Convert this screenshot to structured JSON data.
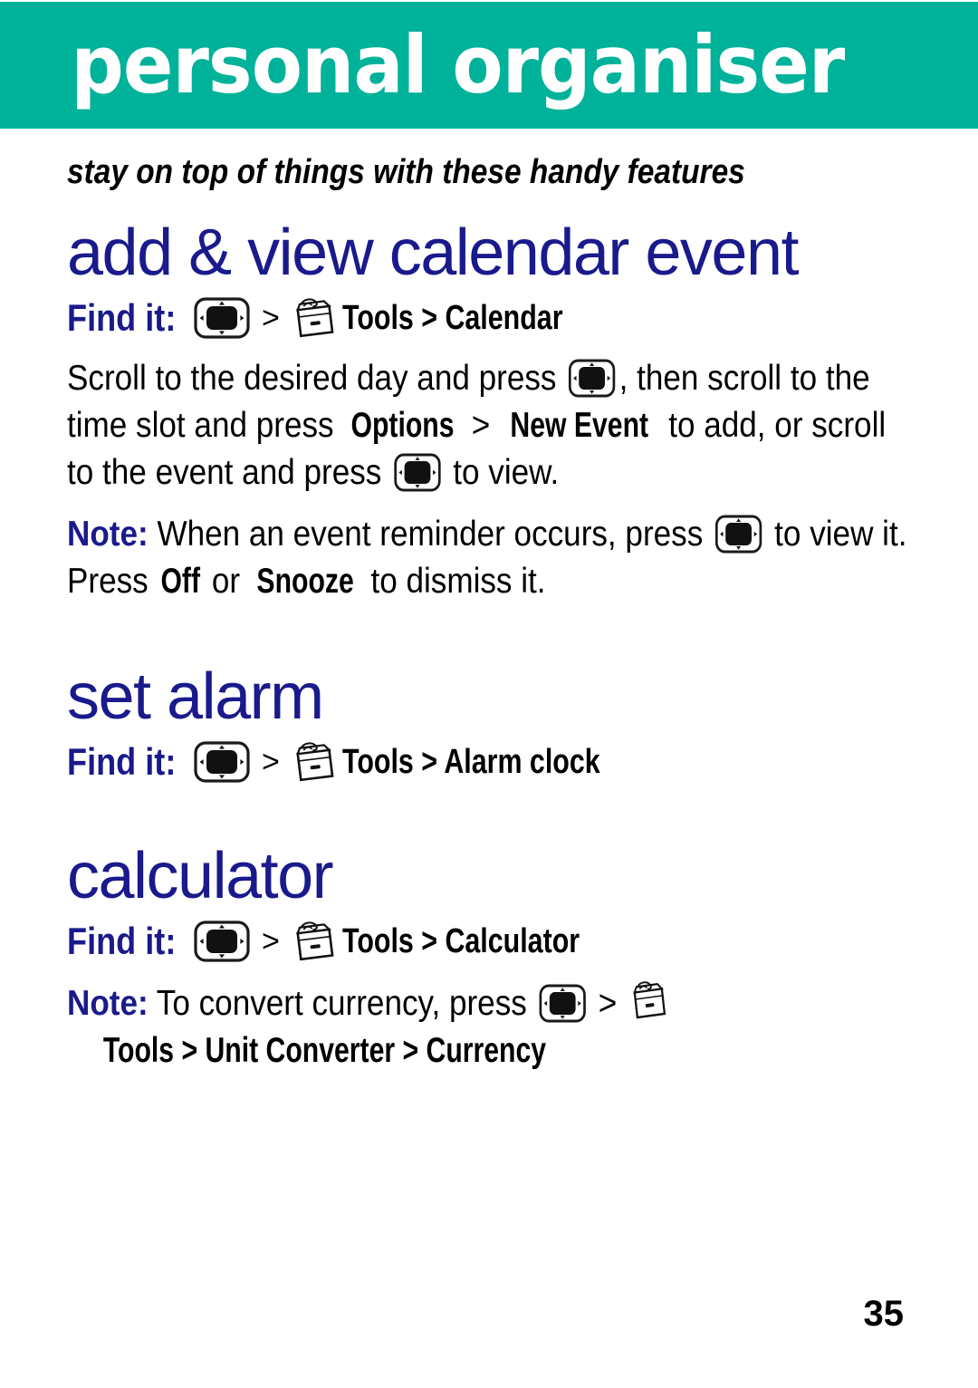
{
  "page": {
    "title": "personal organiser",
    "subtitle": "stay on top of things with these handy features",
    "page_number": "35",
    "colors": {
      "header_band": "#00B29A",
      "heading_blue": "#1A1A8C",
      "body_black": "#000000",
      "title_white": "#FFFFFF"
    }
  },
  "icons": {
    "nav_key": "navigation-key-icon",
    "tools": "tools-card-file-icon",
    "separator": ">"
  },
  "sections": [
    {
      "id": "calendar",
      "heading": "add & view calendar event",
      "find_it": {
        "label": "Find it:",
        "sep1": ">",
        "sep2": ">",
        "path_app": "Tools",
        "path_item": "Calendar",
        "path_full": "Tools > Calendar"
      },
      "paragraphs": [
        {
          "id": "calendar-steps",
          "parts": [
            {
              "t": "text",
              "v": "Scroll to the desired day and press "
            },
            {
              "t": "navkey"
            },
            {
              "t": "text",
              "v": ", then scroll to the time slot and press "
            },
            {
              "t": "ui",
              "v": "Options"
            },
            {
              "t": "text",
              "v": " > "
            },
            {
              "t": "ui",
              "v": "New Event"
            },
            {
              "t": "text",
              "v": " to add, or scroll to the event and press "
            },
            {
              "t": "navkey"
            },
            {
              "t": "text",
              "v": " to view."
            }
          ]
        },
        {
          "id": "calendar-note",
          "parts": [
            {
              "t": "note",
              "v": "Note:"
            },
            {
              "t": "text",
              "v": " When an event reminder occurs, press "
            },
            {
              "t": "navkey"
            },
            {
              "t": "text",
              "v": " to view it. Press "
            },
            {
              "t": "ui",
              "v": "Off"
            },
            {
              "t": "text",
              "v": " or "
            },
            {
              "t": "ui",
              "v": "Snooze"
            },
            {
              "t": "text",
              "v": " to dismiss it."
            }
          ]
        }
      ]
    },
    {
      "id": "alarm",
      "heading": "set alarm",
      "find_it": {
        "label": "Find it:",
        "sep1": ">",
        "sep2": ">",
        "path_app": "Tools",
        "path_item": "Alarm clock",
        "path_full": "Tools >  Alarm clock"
      },
      "paragraphs": []
    },
    {
      "id": "calculator",
      "heading": "calculator",
      "find_it": {
        "label": "Find it:",
        "sep1": ">",
        "sep2": ">",
        "path_app": "Tools",
        "path_item": "Calculator",
        "path_full": "Tools > Calculator"
      },
      "paragraphs": [
        {
          "id": "calculator-note",
          "parts": [
            {
              "t": "note",
              "v": "Note:"
            },
            {
              "t": "text",
              "v": " To convert currency, press "
            },
            {
              "t": "navkey"
            },
            {
              "t": "text",
              "v": " > "
            },
            {
              "t": "toolsicon"
            },
            {
              "t": "ui",
              "v": "Tools > Unit Converter > Currency"
            }
          ]
        }
      ]
    }
  ]
}
